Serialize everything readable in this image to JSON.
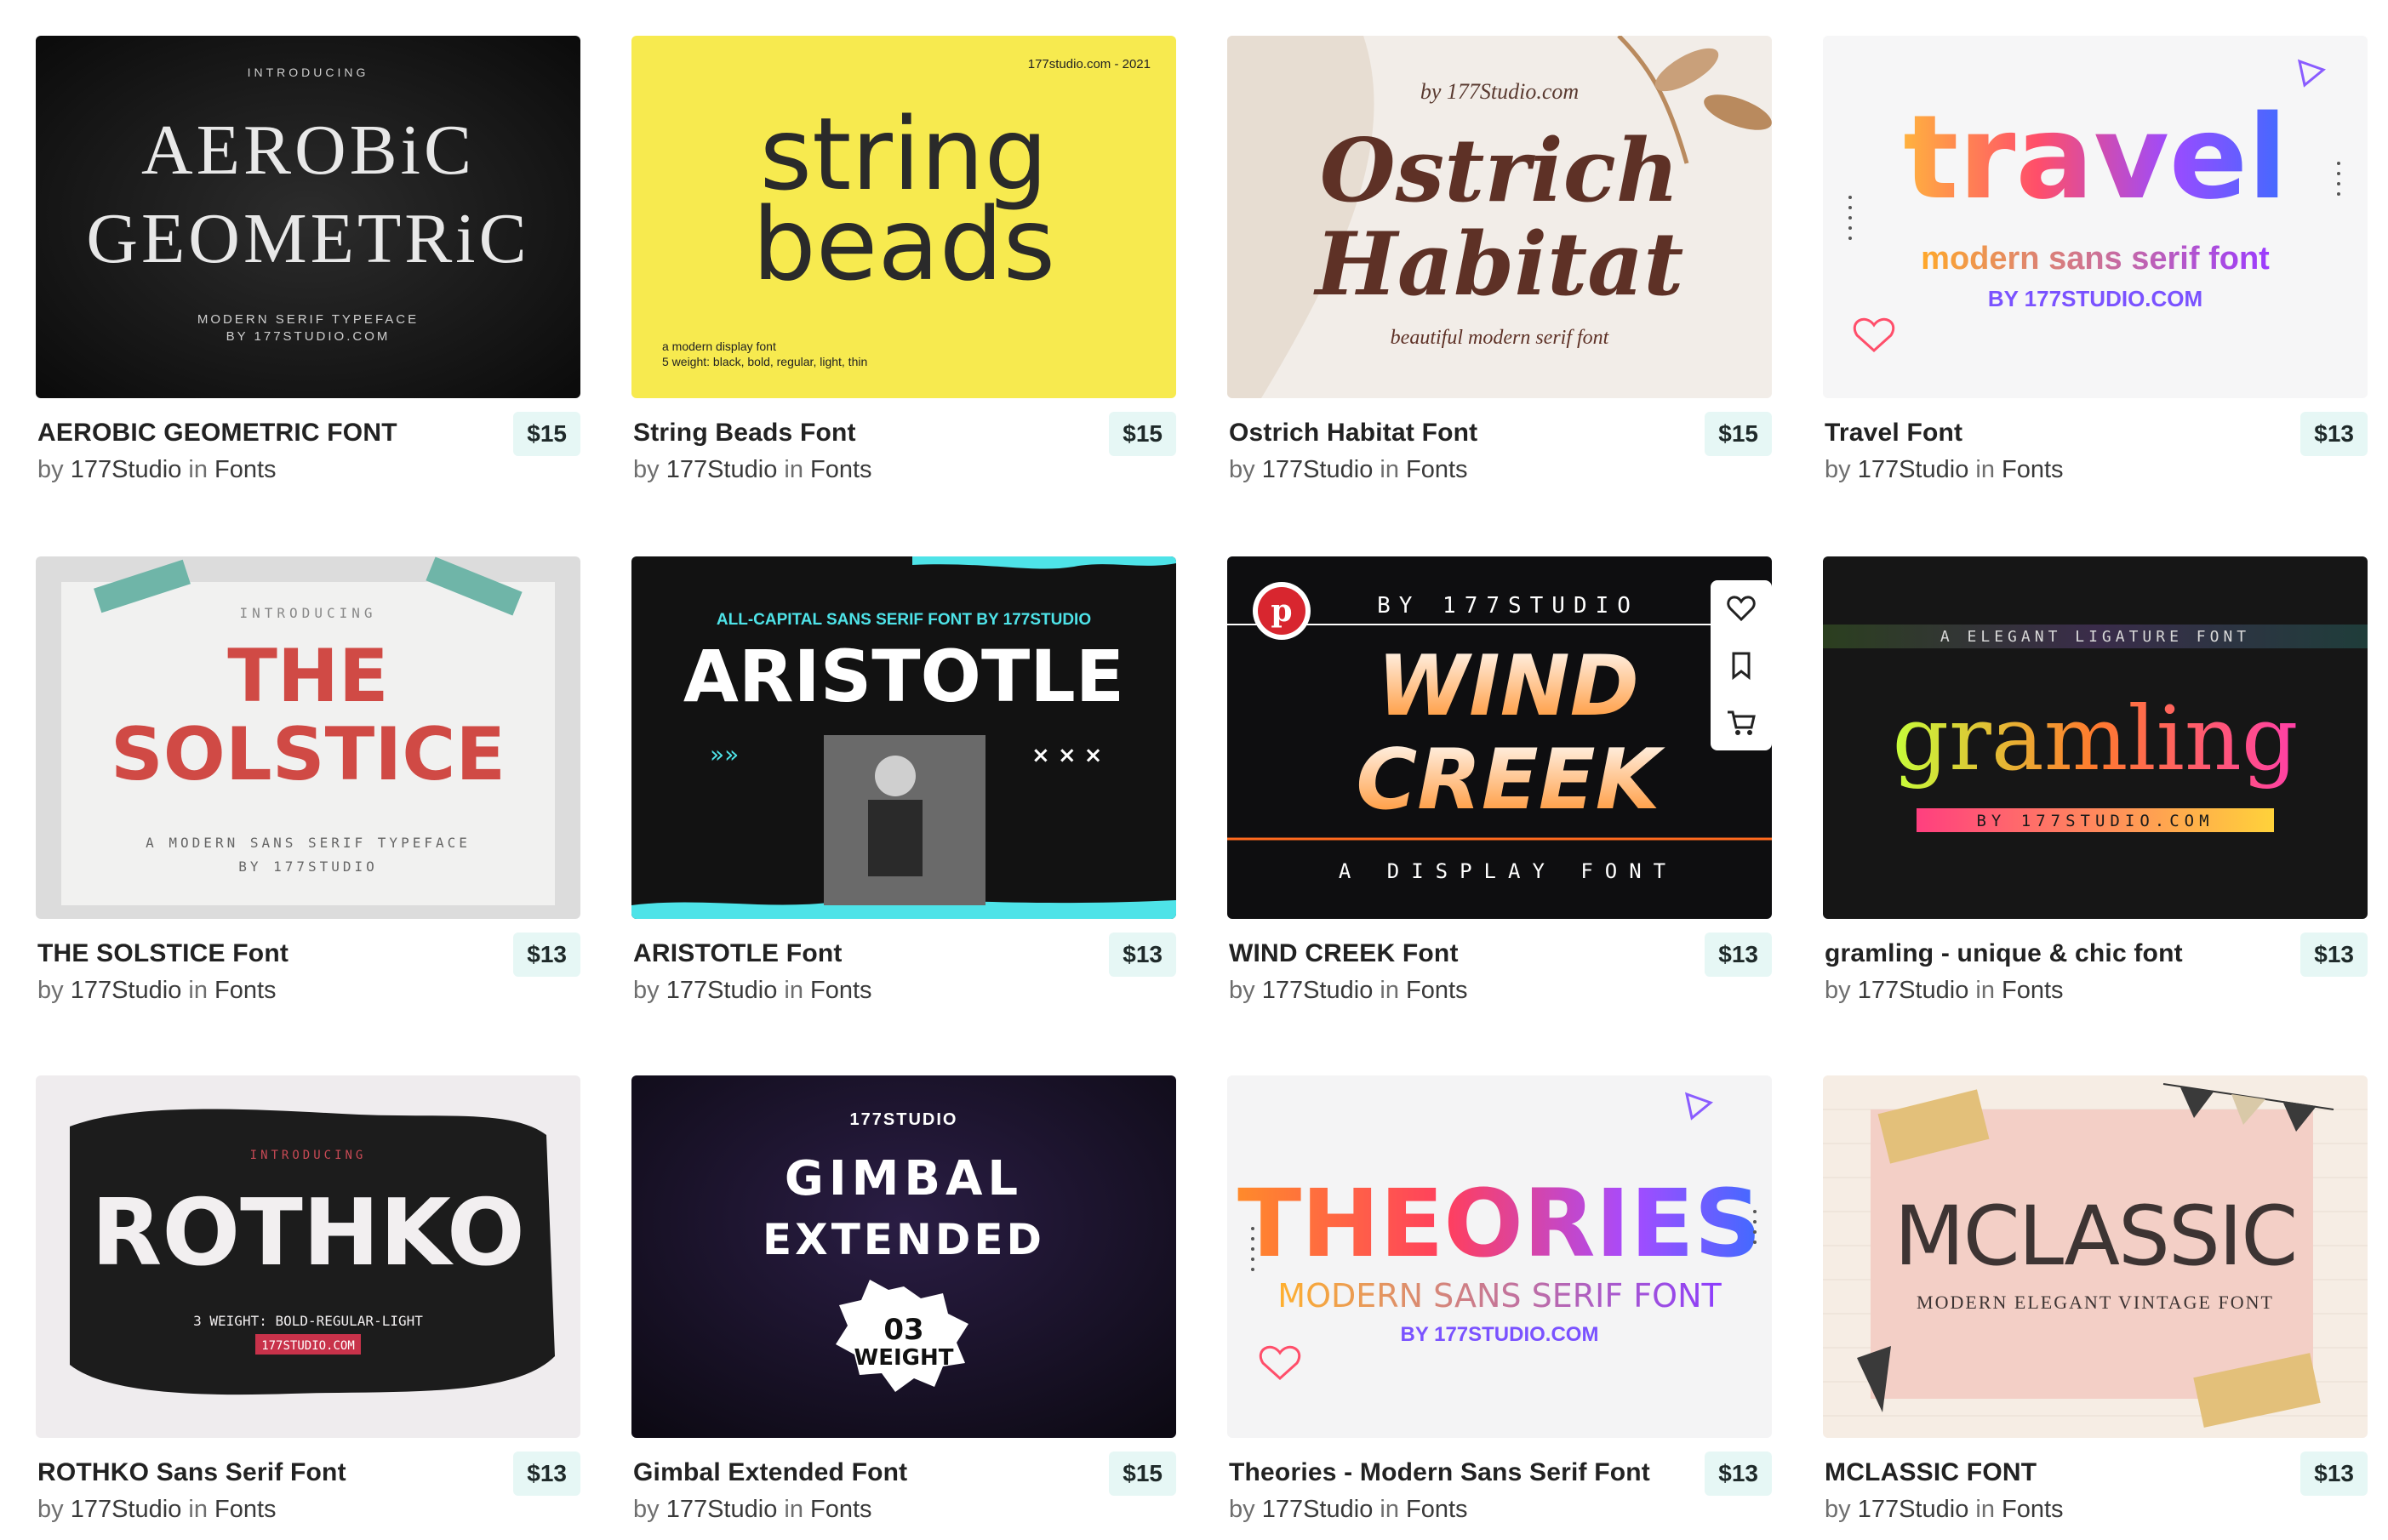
{
  "products": [
    {
      "title": "AEROBIC GEOMETRIC FONT",
      "by": "by",
      "author": "177Studio",
      "in": "in",
      "category": "Fonts",
      "price": "$15",
      "art": {
        "top": "INTRODUCING",
        "line1": "AEROBiC",
        "line2": "GEOMETRiC",
        "sub1": "MODERN SERIF TYPEFACE",
        "sub2": "BY 177STUDIO.COM"
      }
    },
    {
      "title": "String Beads Font",
      "by": "by",
      "author": "177Studio",
      "in": "in",
      "category": "Fonts",
      "price": "$15",
      "art": {
        "top": "177studio.com - 2021",
        "line1": "string",
        "line2": "beads",
        "sub1": "a modern display font",
        "sub2": "5 weight: black, bold, regular, light, thin"
      }
    },
    {
      "title": "Ostrich Habitat Font",
      "by": "by",
      "author": "177Studio",
      "in": "in",
      "category": "Fonts",
      "price": "$15",
      "art": {
        "top": "by 177Studio.com",
        "line1": "Ostrich",
        "line2": "Habitat",
        "sub1": "beautiful modern serif font"
      }
    },
    {
      "title": "Travel Font",
      "by": "by",
      "author": "177Studio",
      "in": "in",
      "category": "Fonts",
      "price": "$13",
      "art": {
        "line1": "travel",
        "sub1": "modern sans serif font",
        "sub2": "BY 177STUDIO.COM"
      }
    },
    {
      "title": "THE SOLSTICE Font",
      "by": "by",
      "author": "177Studio",
      "in": "in",
      "category": "Fonts",
      "price": "$13",
      "art": {
        "top": "INTRODUCING",
        "line1": "THE",
        "line2": "SOLSTICE",
        "sub1": "A MODERN SANS SERIF TYPEFACE",
        "sub2": "BY 177STUDIO"
      }
    },
    {
      "title": "ARISTOTLE Font",
      "by": "by",
      "author": "177Studio",
      "in": "in",
      "category": "Fonts",
      "price": "$13",
      "art": {
        "top": "ALL-CAPITAL SANS SERIF FONT BY 177STUDIO",
        "line1": "ARISTOTLE"
      }
    },
    {
      "title": "WIND CREEK Font",
      "by": "by",
      "author": "177Studio",
      "in": "in",
      "category": "Fonts",
      "price": "$13",
      "art": {
        "top": "BY 177STUDIO",
        "line1": "WIND",
        "line2": "CREEK",
        "sub1": "A DISPLAY FONT"
      }
    },
    {
      "title": "gramling - unique & chic font",
      "by": "by",
      "author": "177Studio",
      "in": "in",
      "category": "Fonts",
      "price": "$13",
      "art": {
        "top": "A ELEGANT LIGATURE FONT",
        "line1": "gramling",
        "sub1": "BY 177STUDIO.COM"
      }
    },
    {
      "title": "ROTHKO Sans Serif Font",
      "by": "by",
      "author": "177Studio",
      "in": "in",
      "category": "Fonts",
      "price": "$13",
      "art": {
        "top": "INTRODUCING",
        "line1": "ROTHKO",
        "sub1": "3 WEIGHT: BOLD-REGULAR-LIGHT",
        "sub2": "177STUDIO.COM"
      }
    },
    {
      "title": "Gimbal Extended Font",
      "by": "by",
      "author": "177Studio",
      "in": "in",
      "category": "Fonts",
      "price": "$15",
      "art": {
        "top": "177STUDIO",
        "line1": "GIMBAL",
        "line2": "EXTENDED",
        "sub1": "03",
        "sub2": "WEIGHT"
      }
    },
    {
      "title": "Theories - Modern Sans Serif Font",
      "by": "by",
      "author": "177Studio",
      "in": "in",
      "category": "Fonts",
      "price": "$13",
      "art": {
        "line1": "THEORIES",
        "sub1": "MODERN SANS SERIF FONT",
        "sub2": "BY 177STUDIO.COM"
      }
    },
    {
      "title": "MCLASSIC FONT",
      "by": "by",
      "author": "177Studio",
      "in": "in",
      "category": "Fonts",
      "price": "$13",
      "art": {
        "line1": "MCLASSIC",
        "sub1": "MODERN ELEGANT VINTAGE FONT"
      }
    }
  ],
  "colors": {
    "price_bg": "#e6f7f5",
    "title": "#222222",
    "byline": "#6e6e6e"
  },
  "icons": {
    "save": "heart-icon",
    "bookmark": "bookmark-icon",
    "cart": "cart-icon",
    "pin": "pinterest-icon"
  }
}
